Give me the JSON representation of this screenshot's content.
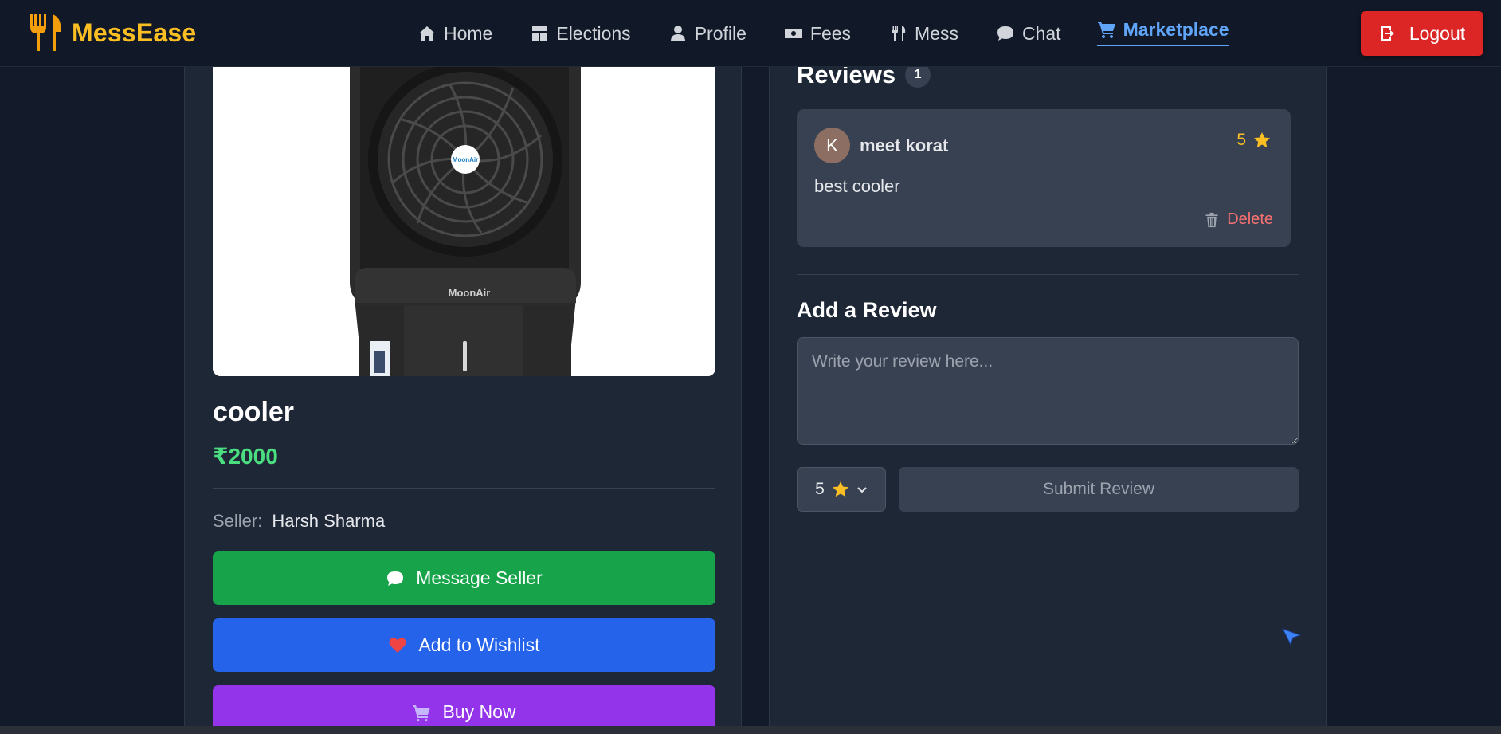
{
  "navbar": {
    "brand": "MessEase",
    "links": [
      {
        "label": "Home",
        "icon": "home-icon"
      },
      {
        "label": "Elections",
        "icon": "elections-icon"
      },
      {
        "label": "Profile",
        "icon": "user-icon"
      },
      {
        "label": "Fees",
        "icon": "money-icon"
      },
      {
        "label": "Mess",
        "icon": "utensils-icon"
      },
      {
        "label": "Chat",
        "icon": "chat-icon"
      },
      {
        "label": "Marketplace",
        "icon": "cart-icon",
        "active": true
      }
    ],
    "logout_label": "Logout"
  },
  "product": {
    "title": "cooler",
    "price": "₹2000",
    "seller_label": "Seller:",
    "seller_name": "Harsh Sharma",
    "image_brand": "MoonAir"
  },
  "actions": {
    "message": "Message Seller",
    "wishlist": "Add to Wishlist",
    "buy": "Buy Now"
  },
  "reviews": {
    "title": "Reviews",
    "count": "1",
    "items": [
      {
        "avatar_letter": "K",
        "name": "meet korat",
        "rating": "5",
        "text": "best cooler",
        "delete_label": "Delete"
      }
    ]
  },
  "add_review": {
    "title": "Add a Review",
    "placeholder": "Write your review here...",
    "rating_value": "5",
    "submit_label": "Submit Review"
  },
  "colors": {
    "accent": "#60a5fa",
    "brand": "#fbbf24",
    "price": "#4ade80",
    "logout": "#dc2626",
    "message": "#16a34a",
    "wishlist": "#2563eb",
    "buy": "#9333ea"
  }
}
